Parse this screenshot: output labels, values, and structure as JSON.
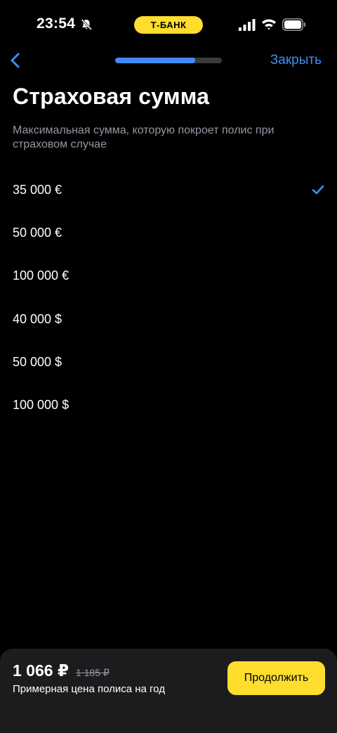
{
  "status_bar": {
    "time": "23:54",
    "brand": "Т-БАНК",
    "icons": [
      "bell-muted-icon",
      "signal-icon",
      "wifi-icon",
      "battery-icon"
    ]
  },
  "nav": {
    "back_icon": "chevron-left-icon",
    "progress": 0.75,
    "close_label": "Закрыть"
  },
  "title": "Страховая сумма",
  "subtitle": "Максимальная сумма, которую покроет полис при страховом случае",
  "options": [
    {
      "label": "35 000 €",
      "selected": true
    },
    {
      "label": "50 000 €",
      "selected": false
    },
    {
      "label": "100 000 €",
      "selected": false
    },
    {
      "label": "40 000 $",
      "selected": false
    },
    {
      "label": "50 000 $",
      "selected": false
    },
    {
      "label": "100 000 $",
      "selected": false
    }
  ],
  "footer": {
    "price": "1 066 ₽",
    "old_price": "1 185 ₽",
    "caption": "Примерная цена полиса на год",
    "continue_label": "Продолжить"
  },
  "colors": {
    "background": "#000000",
    "accent_blue": "#428bf9",
    "brand_yellow": "#ffdd2d",
    "secondary_text": "#9299a2",
    "sheet": "#1c1c1e"
  }
}
